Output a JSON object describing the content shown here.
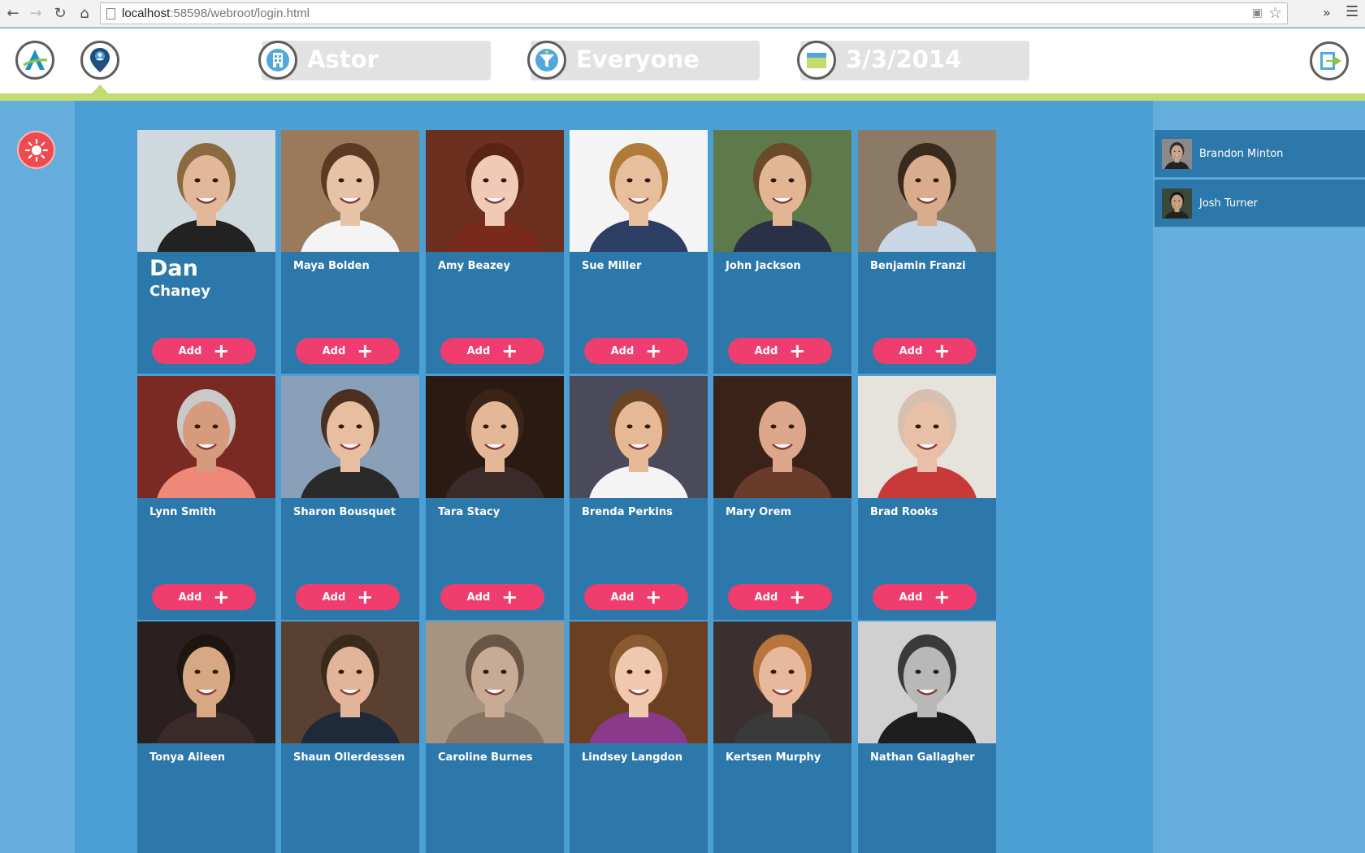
{
  "browser": {
    "url_host": "localhost",
    "url_rest": ":58598/webroot/login.html"
  },
  "header": {
    "building": "Astor",
    "filter": "Everyone",
    "date": "3/3/2014"
  },
  "people": [
    {
      "first": "Dan",
      "last": "Chaney",
      "name": "Dan Chaney",
      "skin": "#e2b79a",
      "hair": "#8a6a3e",
      "bg": "#cfd8dc",
      "shirt": "#222222"
    },
    {
      "name": "Maya Bolden",
      "skin": "#e6c2a6",
      "hair": "#5a3a22",
      "bg": "#9a7a5a",
      "shirt": "#f4f4f4"
    },
    {
      "name": "Amy Beazey",
      "skin": "#f1c9b7",
      "hair": "#5a2414",
      "bg": "#6b3020",
      "shirt": "#7a2a1a"
    },
    {
      "name": "Sue Miller",
      "skin": "#e8bf9c",
      "hair": "#b07a3a",
      "bg": "#f4f4f4",
      "shirt": "#2c3e63"
    },
    {
      "name": "John Jackson",
      "skin": "#e3b693",
      "hair": "#6b4a2a",
      "bg": "#5e7a4a",
      "shirt": "#2a3146"
    },
    {
      "name": "Benjamin Franzi",
      "skin": "#d8ac8c",
      "hair": "#3a2a1c",
      "bg": "#8a7a66",
      "shirt": "#c9d6e6"
    },
    {
      "name": "Lynn Smith",
      "skin": "#d69a7c",
      "hair": "#c9c9c9",
      "bg": "#7a2a22",
      "shirt": "#f0887a"
    },
    {
      "name": "Sharon Bousquet",
      "skin": "#e7bea0",
      "hair": "#4a3020",
      "bg": "#8aa0b8",
      "shirt": "#2a2a2a"
    },
    {
      "name": "Tara Stacy",
      "skin": "#e4b896",
      "hair": "#3a2418",
      "bg": "#2a1a12",
      "shirt": "#3a2a2a"
    },
    {
      "name": "Brenda Perkins",
      "skin": "#e6b896",
      "hair": "#6a4426",
      "bg": "#4a4a5a",
      "shirt": "#f4f4f4"
    },
    {
      "name": "Mary Orem",
      "skin": "#dca68a",
      "hair": "#3a2418",
      "bg": "#3a2218",
      "shirt": "#6a3a2a"
    },
    {
      "name": "Brad Rooks",
      "skin": "#e8c0a8",
      "hair": "#d8c0b0",
      "bg": "#e6e2dc",
      "shirt": "#c83a3a"
    },
    {
      "name": "Tonya Aileen",
      "skin": "#d8a884",
      "hair": "#1e1410",
      "bg": "#2a2020",
      "shirt": "#3a2a2a"
    },
    {
      "name": "Shaun Ollerdessen",
      "skin": "#e2b49a",
      "hair": "#3a2a1c",
      "bg": "#5a4030",
      "shirt": "#1e2a3a"
    },
    {
      "name": "Caroline Burnes",
      "skin": "#c8ab94",
      "hair": "#6a5444",
      "bg": "#a89280",
      "shirt": "#8a7464"
    },
    {
      "name": "Lindsey Langdon",
      "skin": "#f0c8b0",
      "hair": "#8a5a30",
      "bg": "#6a4020",
      "shirt": "#8a3a8a"
    },
    {
      "name": "Kertsen Murphy",
      "skin": "#e8b89c",
      "hair": "#b8743a",
      "bg": "#3a3030",
      "shirt": "#3a3a3a"
    },
    {
      "name": "Nathan Gallagher",
      "skin": "#b8b8b8",
      "hair": "#3a3a3a",
      "bg": "#d0d0d0",
      "shirt": "#1e1e1e"
    }
  ],
  "add_label": "Add",
  "selected": [
    {
      "name": "Brandon Minton",
      "skin": "#c8a48a",
      "hair": "#2a2a2a",
      "bg": "#8a8a8a"
    },
    {
      "name": "Josh Turner",
      "skin": "#c8a080",
      "hair": "#1a1a1a",
      "bg": "#3a4a3a"
    }
  ],
  "colors": {
    "accent_green": "#c3dc6f",
    "card_blue": "#2d78aa",
    "add_pink": "#f03d6f",
    "main_blue": "#4c9fd4"
  }
}
